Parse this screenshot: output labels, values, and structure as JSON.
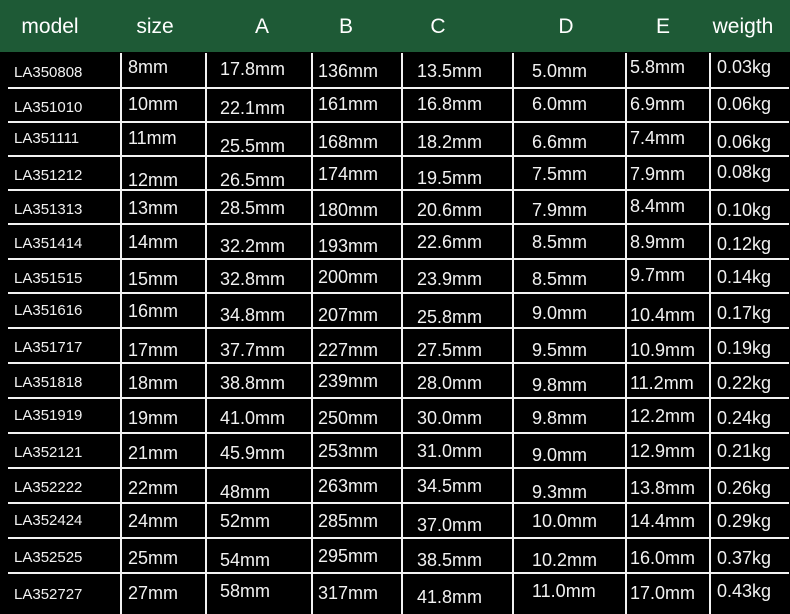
{
  "header_color": "#1e5a36",
  "columns": [
    "model",
    "size",
    "A",
    "B",
    "C",
    "D",
    "E",
    "weigth"
  ],
  "rows": [
    [
      "LA350808",
      "8mm",
      "17.8mm",
      "136mm",
      "13.5mm",
      "5.0mm",
      "5.8mm",
      "0.03kg"
    ],
    [
      "LA351010",
      "10mm",
      "22.1mm",
      "161mm",
      "16.8mm",
      "6.0mm",
      "6.9mm",
      "0.06kg"
    ],
    [
      "LA351111",
      "11mm",
      "25.5mm",
      "168mm",
      "18.2mm",
      "6.6mm",
      "7.4mm",
      "0.06kg"
    ],
    [
      "LA351212",
      "12mm",
      "26.5mm",
      "174mm",
      "19.5mm",
      "7.5mm",
      "7.9mm",
      "0.08kg"
    ],
    [
      "LA351313",
      "13mm",
      "28.5mm",
      "180mm",
      "20.6mm",
      "7.9mm",
      "8.4mm",
      "0.10kg"
    ],
    [
      "LA351414",
      "14mm",
      "32.2mm",
      "193mm",
      "22.6mm",
      "8.5mm",
      "8.9mm",
      "0.12kg"
    ],
    [
      "LA351515",
      "15mm",
      "32.8mm",
      "200mm",
      "23.9mm",
      "8.5mm",
      "9.7mm",
      "0.14kg"
    ],
    [
      "LA351616",
      "16mm",
      "34.8mm",
      "207mm",
      "25.8mm",
      "9.0mm",
      "10.4mm",
      "0.17kg"
    ],
    [
      "LA351717",
      "17mm",
      "37.7mm",
      "227mm",
      "27.5mm",
      "9.5mm",
      "10.9mm",
      "0.19kg"
    ],
    [
      "LA351818",
      "18mm",
      "38.8mm",
      "239mm",
      "28.0mm",
      "9.8mm",
      "11.2mm",
      "0.22kg"
    ],
    [
      "LA351919",
      "19mm",
      "41.0mm",
      "250mm",
      "30.0mm",
      "9.8mm",
      "12.2mm",
      "0.24kg"
    ],
    [
      "LA352121",
      "21mm",
      "45.9mm",
      "253mm",
      "31.0mm",
      "9.0mm",
      "12.9mm",
      "0.21kg"
    ],
    [
      "LA352222",
      "22mm",
      "48mm",
      "263mm",
      "34.5mm",
      "9.3mm",
      "13.8mm",
      "0.26kg"
    ],
    [
      "LA352424",
      "24mm",
      "52mm",
      "285mm",
      "37.0mm",
      "10.0mm",
      "14.4mm",
      "0.29kg"
    ],
    [
      "LA352525",
      "25mm",
      "54mm",
      "295mm",
      "38.5mm",
      "10.2mm",
      "16.0mm",
      "0.37kg"
    ],
    [
      "LA352727",
      "27mm",
      "58mm",
      "317mm",
      "41.8mm",
      "11.0mm",
      "17.0mm",
      "0.43kg"
    ]
  ]
}
